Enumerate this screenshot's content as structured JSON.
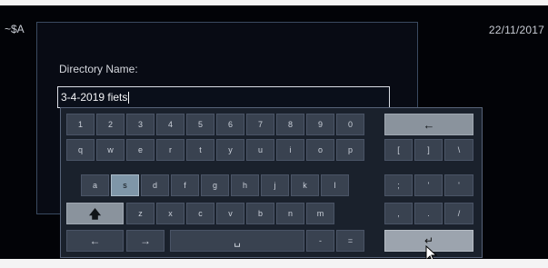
{
  "status_bar": {
    "left_text": "~$A",
    "date": "22/11/2017"
  },
  "dialog": {
    "label": "Directory Name:",
    "input_value": "3-4-2019 fiets"
  },
  "keyboard": {
    "digits": [
      "1",
      "2",
      "3",
      "4",
      "5",
      "6",
      "7",
      "8",
      "9",
      "0"
    ],
    "row_q": [
      "q",
      "w",
      "e",
      "r",
      "t",
      "y",
      "u",
      "i",
      "o",
      "p"
    ],
    "row_a": [
      "a",
      "s",
      "d",
      "f",
      "g",
      "h",
      "j",
      "k",
      "l"
    ],
    "row_z": [
      "z",
      "x",
      "c",
      "v",
      "b",
      "n",
      "m"
    ],
    "symbols_row1": [
      "[",
      "]",
      "\\"
    ],
    "symbols_row2": [
      ";",
      "'",
      "'"
    ],
    "symbols_row3": [
      ",",
      ".",
      "/"
    ],
    "minus": "-",
    "equals": "=",
    "selected_key": "s",
    "icons": {
      "backspace": "arrow-left-icon",
      "shift": "arrow-up-icon",
      "left": "arrow-left-icon",
      "right": "arrow-right-icon",
      "space": "space-bar-icon",
      "enter": "enter-icon"
    }
  }
}
